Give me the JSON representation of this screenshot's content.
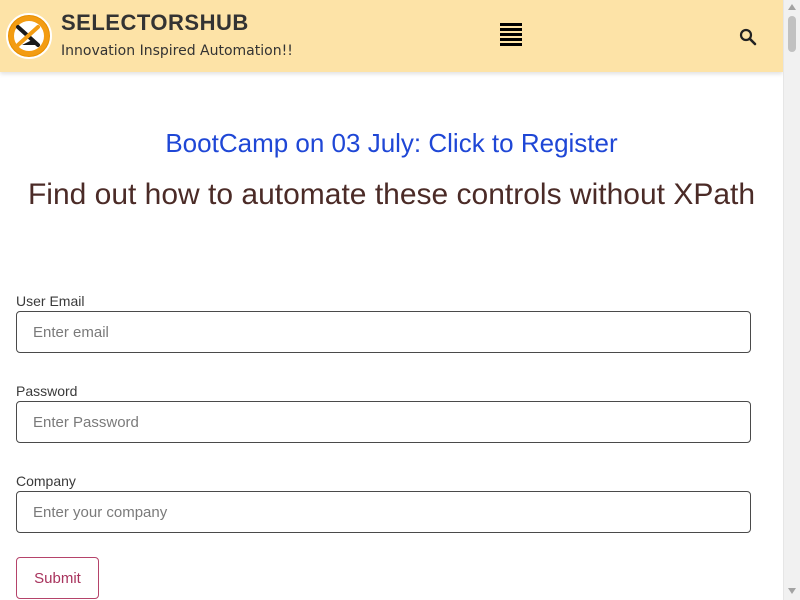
{
  "header": {
    "brand_title": "SELECTORSHUB",
    "tagline": "Innovation Inspired Automation!!",
    "menu_icon": "hamburger-menu-icon",
    "search_icon": "search-icon",
    "background_color": "#fde3a7"
  },
  "content": {
    "bootcamp_link": "BootCamp on 03 July: Click to Register",
    "heading": "Find out how to automate these controls without XPath"
  },
  "form": {
    "email": {
      "label": "User Email",
      "placeholder": "Enter email",
      "value": ""
    },
    "password": {
      "label": "Password",
      "placeholder": "Enter Password",
      "value": ""
    },
    "company": {
      "label": "Company",
      "placeholder": "Enter your company",
      "value": ""
    },
    "submit_label": "Submit"
  },
  "colors": {
    "link": "#1f47d6",
    "heading": "#4b2b27",
    "submit_border": "#b5436a",
    "logo_accent": "#f39c12"
  }
}
